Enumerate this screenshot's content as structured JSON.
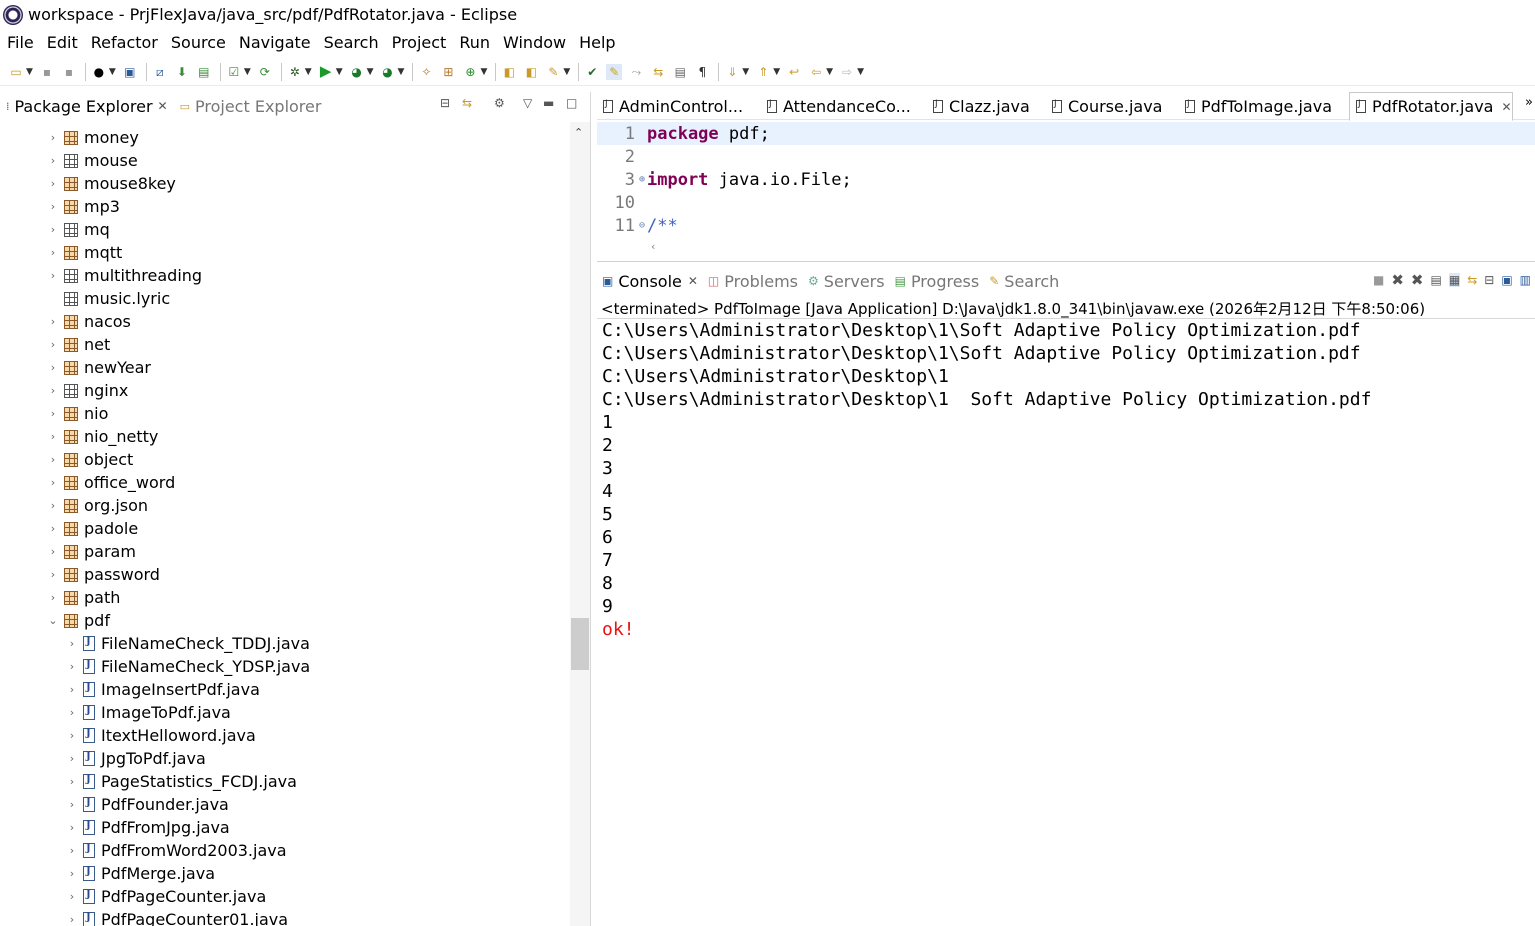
{
  "window": {
    "title": "workspace - PrjFlexJava/java_src/pdf/PdfRotator.java - Eclipse"
  },
  "menu": [
    "File",
    "Edit",
    "Refactor",
    "Source",
    "Navigate",
    "Search",
    "Project",
    "Run",
    "Window",
    "Help"
  ],
  "left_panel": {
    "tabs": [
      {
        "label": "Package Explorer",
        "active": true
      },
      {
        "label": "Project Explorer",
        "active": false
      }
    ],
    "tree": [
      {
        "label": "money",
        "kind": "package",
        "expandable": true,
        "expanded": false,
        "level": 0
      },
      {
        "label": "mouse",
        "kind": "package-empty",
        "expandable": true,
        "expanded": false,
        "level": 0
      },
      {
        "label": "mouse8key",
        "kind": "package",
        "expandable": true,
        "expanded": false,
        "level": 0
      },
      {
        "label": "mp3",
        "kind": "package",
        "expandable": true,
        "expanded": false,
        "level": 0
      },
      {
        "label": "mq",
        "kind": "package-empty",
        "expandable": true,
        "expanded": false,
        "level": 0
      },
      {
        "label": "mqtt",
        "kind": "package",
        "expandable": true,
        "expanded": false,
        "level": 0
      },
      {
        "label": "multithreading",
        "kind": "package-empty",
        "expandable": true,
        "expanded": false,
        "level": 0
      },
      {
        "label": "music.lyric",
        "kind": "package-empty",
        "expandable": false,
        "expanded": false,
        "level": 0
      },
      {
        "label": "nacos",
        "kind": "package",
        "expandable": true,
        "expanded": false,
        "level": 0
      },
      {
        "label": "net",
        "kind": "package",
        "expandable": true,
        "expanded": false,
        "level": 0
      },
      {
        "label": "newYear",
        "kind": "package",
        "expandable": true,
        "expanded": false,
        "level": 0
      },
      {
        "label": "nginx",
        "kind": "package-empty",
        "expandable": true,
        "expanded": false,
        "level": 0
      },
      {
        "label": "nio",
        "kind": "package",
        "expandable": true,
        "expanded": false,
        "level": 0
      },
      {
        "label": "nio_netty",
        "kind": "package",
        "expandable": true,
        "expanded": false,
        "level": 0
      },
      {
        "label": "object",
        "kind": "package",
        "expandable": true,
        "expanded": false,
        "level": 0
      },
      {
        "label": "office_word",
        "kind": "package",
        "expandable": true,
        "expanded": false,
        "level": 0
      },
      {
        "label": "org.json",
        "kind": "package",
        "expandable": true,
        "expanded": false,
        "level": 0
      },
      {
        "label": "padole",
        "kind": "package",
        "expandable": true,
        "expanded": false,
        "level": 0
      },
      {
        "label": "param",
        "kind": "package",
        "expandable": true,
        "expanded": false,
        "level": 0
      },
      {
        "label": "password",
        "kind": "package",
        "expandable": true,
        "expanded": false,
        "level": 0
      },
      {
        "label": "path",
        "kind": "package",
        "expandable": true,
        "expanded": false,
        "level": 0
      },
      {
        "label": "pdf",
        "kind": "package",
        "expandable": true,
        "expanded": true,
        "level": 0
      },
      {
        "label": "FileNameCheck_TDDJ.java",
        "kind": "java",
        "expandable": true,
        "expanded": false,
        "level": 1
      },
      {
        "label": "FileNameCheck_YDSP.java",
        "kind": "java",
        "expandable": true,
        "expanded": false,
        "level": 1
      },
      {
        "label": "ImageInsertPdf.java",
        "kind": "java",
        "expandable": true,
        "expanded": false,
        "level": 1
      },
      {
        "label": "ImageToPdf.java",
        "kind": "java",
        "expandable": true,
        "expanded": false,
        "level": 1
      },
      {
        "label": "ItextHelloword.java",
        "kind": "java",
        "expandable": true,
        "expanded": false,
        "level": 1
      },
      {
        "label": "JpgToPdf.java",
        "kind": "java",
        "expandable": true,
        "expanded": false,
        "level": 1
      },
      {
        "label": "PageStatistics_FCDJ.java",
        "kind": "java",
        "expandable": true,
        "expanded": false,
        "level": 1
      },
      {
        "label": "PdfFounder.java",
        "kind": "java",
        "expandable": true,
        "expanded": false,
        "level": 1
      },
      {
        "label": "PdfFromJpg.java",
        "kind": "java",
        "expandable": true,
        "expanded": false,
        "level": 1
      },
      {
        "label": "PdfFromWord2003.java",
        "kind": "java",
        "expandable": true,
        "expanded": false,
        "level": 1
      },
      {
        "label": "PdfMerge.java",
        "kind": "java",
        "expandable": true,
        "expanded": false,
        "level": 1
      },
      {
        "label": "PdfPageCounter.java",
        "kind": "java",
        "expandable": true,
        "expanded": false,
        "level": 1
      },
      {
        "label": "PdfPageCounter01.java",
        "kind": "java",
        "expandable": true,
        "expanded": false,
        "level": 1
      }
    ]
  },
  "editor": {
    "tabs": [
      {
        "label": "AdminControl...",
        "active": false
      },
      {
        "label": "AttendanceCo...",
        "active": false
      },
      {
        "label": "Clazz.java",
        "active": false
      },
      {
        "label": "Course.java",
        "active": false
      },
      {
        "label": "PdfToImage.java",
        "active": false
      },
      {
        "label": "PdfRotator.java",
        "active": true
      }
    ],
    "overflow_label": "»",
    "lines": [
      {
        "num": "1",
        "fold": "",
        "keyword": "package",
        "rest": " pdf;",
        "current": true
      },
      {
        "num": "2",
        "fold": "",
        "keyword": "",
        "rest": "",
        "current": false
      },
      {
        "num": "3",
        "fold": "⊕",
        "keyword": "import",
        "rest": " java.io.File;",
        "current": false
      },
      {
        "num": "10",
        "fold": "",
        "keyword": "",
        "rest": "",
        "current": false
      },
      {
        "num": "11",
        "fold": "⊖",
        "keyword": "",
        "rest": "/**",
        "current": false,
        "comment": true
      }
    ]
  },
  "console": {
    "tabs": [
      {
        "label": "Console",
        "active": true,
        "icon": "console-icon"
      },
      {
        "label": "Problems",
        "active": false,
        "icon": "problems-icon"
      },
      {
        "label": "Servers",
        "active": false,
        "icon": "servers-icon"
      },
      {
        "label": "Progress",
        "active": false,
        "icon": "progress-icon"
      },
      {
        "label": "Search",
        "active": false,
        "icon": "search-icon"
      }
    ],
    "status": "<terminated> PdfToImage [Java Application] D:\\Java\\jdk1.8.0_341\\bin\\javaw.exe (2026年2月12日 下午8:50:06)",
    "output": [
      {
        "text": "C:\\Users\\Administrator\\Desktop\\1\\Soft Adaptive Policy Optimization.pdf",
        "error": false
      },
      {
        "text": "C:\\Users\\Administrator\\Desktop\\1\\Soft Adaptive Policy Optimization.pdf",
        "error": false
      },
      {
        "text": "C:\\Users\\Administrator\\Desktop\\1",
        "error": false
      },
      {
        "text": "C:\\Users\\Administrator\\Desktop\\1  Soft Adaptive Policy Optimization.pdf",
        "error": false
      },
      {
        "text": "1",
        "error": false
      },
      {
        "text": "2",
        "error": false
      },
      {
        "text": "3",
        "error": false
      },
      {
        "text": "4",
        "error": false
      },
      {
        "text": "5",
        "error": false
      },
      {
        "text": "6",
        "error": false
      },
      {
        "text": "7",
        "error": false
      },
      {
        "text": "8",
        "error": false
      },
      {
        "text": "9",
        "error": false
      },
      {
        "text": "ok!",
        "error": true
      }
    ]
  },
  "colors": {
    "keyword": "#7f0055",
    "comment": "#3f5fbf",
    "error_output": "#ee1111",
    "current_line": "#e8f2fe"
  }
}
